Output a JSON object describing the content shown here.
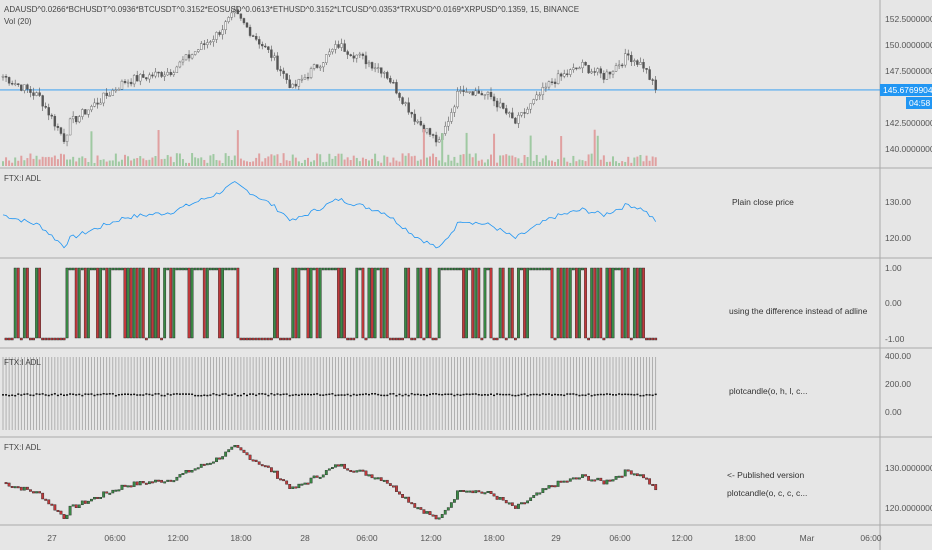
{
  "header": {
    "symbol": "ADAUSD^0.0266*BCHUSDT^0.0936*BTCUSDT^0.3152*EOSUSD^0.0613*ETHUSD^0.3152*LTCUSD^0.0353*TRXUSD^0.0169*XRPUSD^0.1359, 15, BINANCE",
    "volume": "Vol (20)"
  },
  "panes": [
    {
      "axis": [
        "152.50000000",
        "150.00000000",
        "147.50000000",
        "142.50000000",
        "140.00000000"
      ],
      "last_price": "145.67699041",
      "countdown": "04:58"
    },
    {
      "title": "FTX:I ADL",
      "axis": [
        "130.00",
        "120.00"
      ],
      "note": "Plain close price"
    },
    {
      "title": "FTX:I ADL",
      "axis": [
        "1.00",
        "0.00",
        "-1.00"
      ],
      "note": "using the difference instead of adline"
    },
    {
      "title": "FTX:I ADL",
      "axis": [
        "400.00",
        "200.00",
        "0.00"
      ],
      "note": "plotcandle(o, h, l, c..."
    },
    {
      "title": "FTX:I ADL",
      "axis": [
        "130.00000000",
        "120.00000000"
      ],
      "note": "<- Published version",
      "note2": "plotcandle(o, c, c, c..."
    }
  ],
  "time_axis": [
    "27",
    "06:00",
    "12:00",
    "18:00",
    "28",
    "06:00",
    "12:00",
    "18:00",
    "29",
    "06:00",
    "12:00",
    "18:00",
    "Mar",
    "06:00"
  ],
  "colors": {
    "up": "#3a8a45",
    "down": "#c0393b",
    "line": "#2196f3",
    "grid": "#bdbdbd"
  },
  "chart_data": {
    "type": "candlestick",
    "bars": 215,
    "anchors": [
      [
        0,
        147
      ],
      [
        12,
        145
      ],
      [
        20,
        141
      ],
      [
        22,
        142.5
      ],
      [
        40,
        146.5
      ],
      [
        55,
        147.5
      ],
      [
        70,
        151
      ],
      [
        76,
        153
      ],
      [
        88,
        149
      ],
      [
        95,
        145.8
      ],
      [
        110,
        150
      ],
      [
        125,
        147.5
      ],
      [
        135,
        143
      ],
      [
        143,
        140.5
      ],
      [
        150,
        146
      ],
      [
        160,
        145
      ],
      [
        168,
        142.5
      ],
      [
        180,
        146.5
      ],
      [
        190,
        148
      ],
      [
        197,
        147
      ],
      [
        205,
        149
      ],
      [
        210,
        148
      ],
      [
        214,
        145.7
      ]
    ],
    "price_range": [
      138.5,
      153.5
    ],
    "adl_range": [
      115,
      138
    ]
  }
}
